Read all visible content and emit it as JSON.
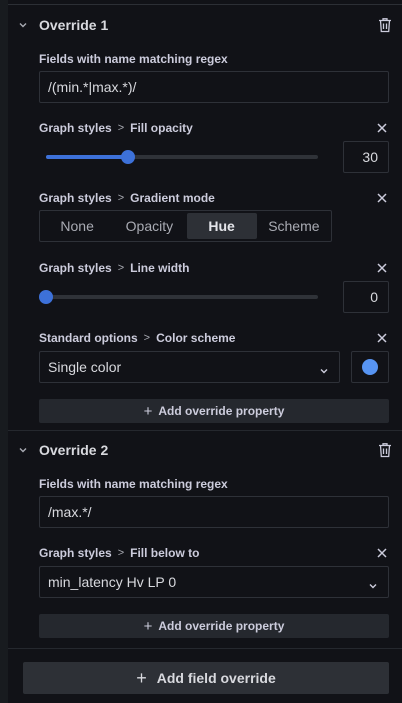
{
  "overrides": [
    {
      "title": "Override 1",
      "matcher": {
        "label": "Fields with name matching regex",
        "value": "/(min.*|max.*)/"
      },
      "properties": [
        {
          "category": "Graph styles",
          "name": "Fill opacity",
          "value": "30",
          "slider_fraction": 0.3
        },
        {
          "category": "Graph styles",
          "name": "Gradient mode",
          "options": [
            "None",
            "Opacity",
            "Hue",
            "Scheme"
          ],
          "selected": "Hue"
        },
        {
          "category": "Graph styles",
          "name": "Line width",
          "value": "0",
          "slider_fraction": 0.0
        },
        {
          "category": "Standard options",
          "name": "Color scheme",
          "selected": "Single color",
          "color": "#5794f2"
        }
      ],
      "add_property_label": "Add override property"
    },
    {
      "title": "Override 2",
      "matcher": {
        "label": "Fields with name matching regex",
        "value": "/max.*/"
      },
      "properties": [
        {
          "category": "Graph styles",
          "name": "Fill below to",
          "selected": "min_latency Hv LP 0"
        }
      ],
      "add_property_label": "Add override property"
    }
  ],
  "add_field_override_label": "Add field override",
  "separator": ">",
  "icons": {
    "collapse": "chevron-down-icon",
    "delete": "trash-icon",
    "remove": "close-icon",
    "dropdown": "chevron-down-icon",
    "add": "plus-icon"
  },
  "colors": {
    "accent": "#3d71d9",
    "series_color": "#5794f2"
  }
}
